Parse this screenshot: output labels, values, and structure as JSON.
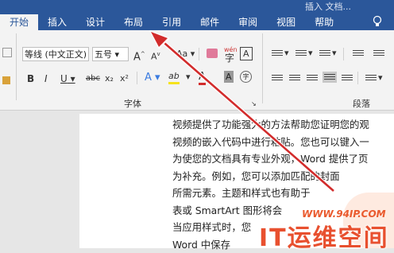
{
  "titlebar": {
    "fragment": "插入 文档..."
  },
  "tabs": [
    "开始",
    "插入",
    "设计",
    "布局",
    "引用",
    "邮件",
    "审阅",
    "视图",
    "帮助"
  ],
  "active_tab": "开始",
  "icons": {
    "lightbulb": "lightbulb-icon"
  },
  "font_group": {
    "font_name": "等线 (中文正文)",
    "font_size": "五号",
    "grow_label": "A",
    "shrink_label": "A",
    "aa_label": "Aa",
    "wen_label": "wén",
    "bold": "B",
    "italic": "I",
    "underline": "U",
    "strike": "abc",
    "subscript": "x₂",
    "superscript": "x²",
    "text_effect": "A",
    "highlight": "ab",
    "font_color": "A",
    "shading": "A",
    "enclose": "字",
    "border_a": "A",
    "label": "字体"
  },
  "paragraph_group": {
    "label": "段落"
  },
  "document": {
    "lines": [
      "视频提供了功能强大的方法帮助您证明您的观",
      "视频的嵌入代码中进行粘贴。您也可以键入一",
      "为使您的文档具有专业外观，Word 提供了页",
      "为补充。例如，您可以添加匹配的封面",
      "所需元素。主题和样式也有助于",
      "表或 SmartArt 图形将会",
      "当应用样式时，您",
      "Word 中保存"
    ]
  },
  "watermark": {
    "url": "WWW.94IP.COM",
    "brand": "IT运维空间"
  },
  "colors": {
    "ribbon_blue": "#2b579a",
    "arrow_red": "#d22c2c",
    "watermark": "#e8502f"
  }
}
